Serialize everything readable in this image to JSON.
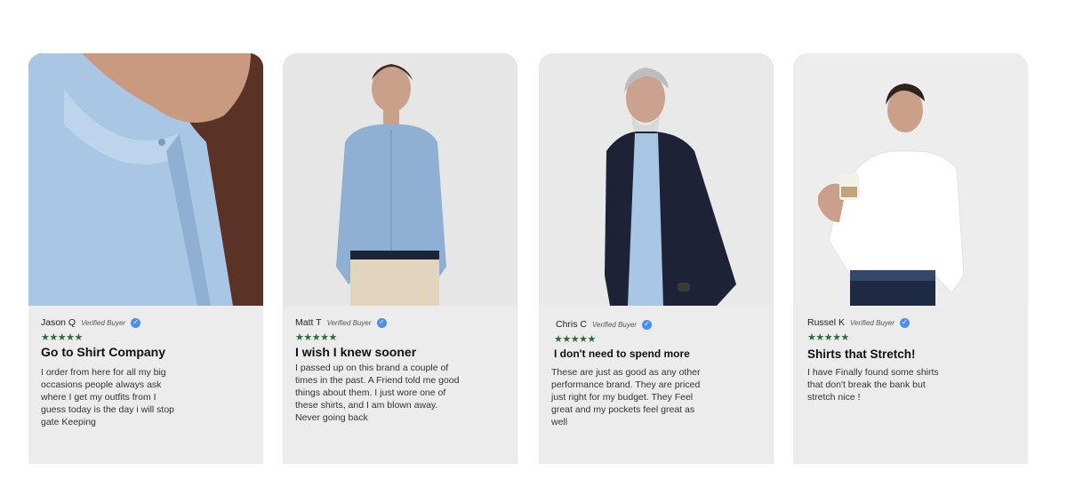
{
  "reviews": [
    {
      "name": "Jason Q",
      "verified": "Verified Buyer",
      "stars": "★★★★★",
      "title": "Go to Shirt Company",
      "text": "I order from here for all my big occasions people always ask where I get my outfits from I guess today is the day i will stop gate Keeping"
    },
    {
      "name": "Matt T",
      "verified": "Verified Buyer",
      "stars": "★★★★★",
      "title": "I wish I knew sooner",
      "text": "I passed up on this brand a couple of times in the past. A Friend told me good things about them. I just wore one of these shirts, and I am blown away. Never going back"
    },
    {
      "name": "Chris C",
      "verified": "Verified Buyer",
      "stars": "★★★★★",
      "title": "I don't need to spend more",
      "text": "These are just as good as any other performance brand. They are priced just right for my budget. They Feel great and my pockets feel great as well"
    },
    {
      "name": "Russel K",
      "verified": "Verified Buyer",
      "stars": "★★★★★",
      "title": "Shirts that Stretch!",
      "text": "I have Finally found some shirts that don't break the bank but stretch nice !"
    }
  ],
  "colors": {
    "card_bg": "#ececec",
    "star_green": "#2f6b36",
    "verified_blue": "#4b8ef0",
    "shirt_light_blue": "#a9c6e4"
  }
}
